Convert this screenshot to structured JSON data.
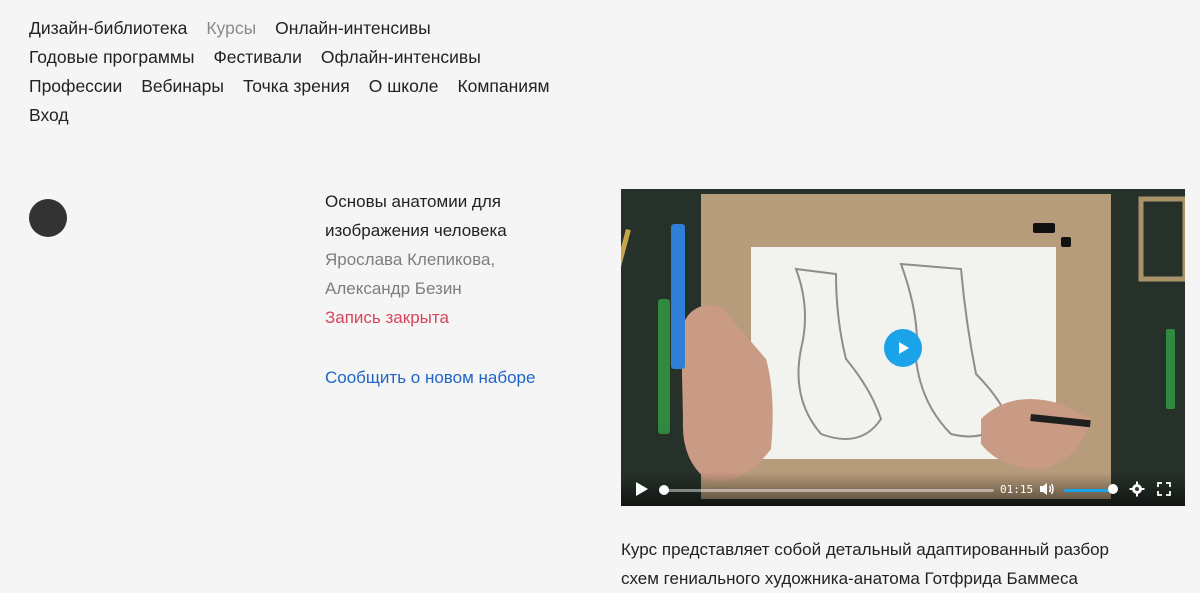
{
  "nav": {
    "rows": [
      [
        "Дизайн-библиотека",
        "Курсы",
        "Онлайн-интенсивы"
      ],
      [
        "Годовые программы",
        "Фестивали",
        "Офлайн-интенсивы"
      ],
      [
        "Профессии",
        "Вебинары",
        "Точка зрения",
        "О школе",
        "Компаниям"
      ],
      [
        "Вход"
      ]
    ],
    "active": "Курсы"
  },
  "course": {
    "title_line1": "Основы анатомии для",
    "title_line2": "изображения человека",
    "author1": "Ярослава Клепикова,",
    "author2": "Александр Безин",
    "status": "Запись закрыта",
    "status_color": "#d6455a",
    "notify_link": "Сообщить о новом наборе"
  },
  "video": {
    "time": "01:15",
    "progress": 0.02,
    "volume": 0.9,
    "accent_color": "#1aa3e8",
    "icons": [
      "play-icon",
      "volume-icon",
      "settings-gear-icon",
      "fullscreen-icon"
    ]
  },
  "description": {
    "line1": "Курс представляет собой детальный адаптированный разбор",
    "line2": "схем гениального художника-анатома Готфрида Баммеса"
  }
}
